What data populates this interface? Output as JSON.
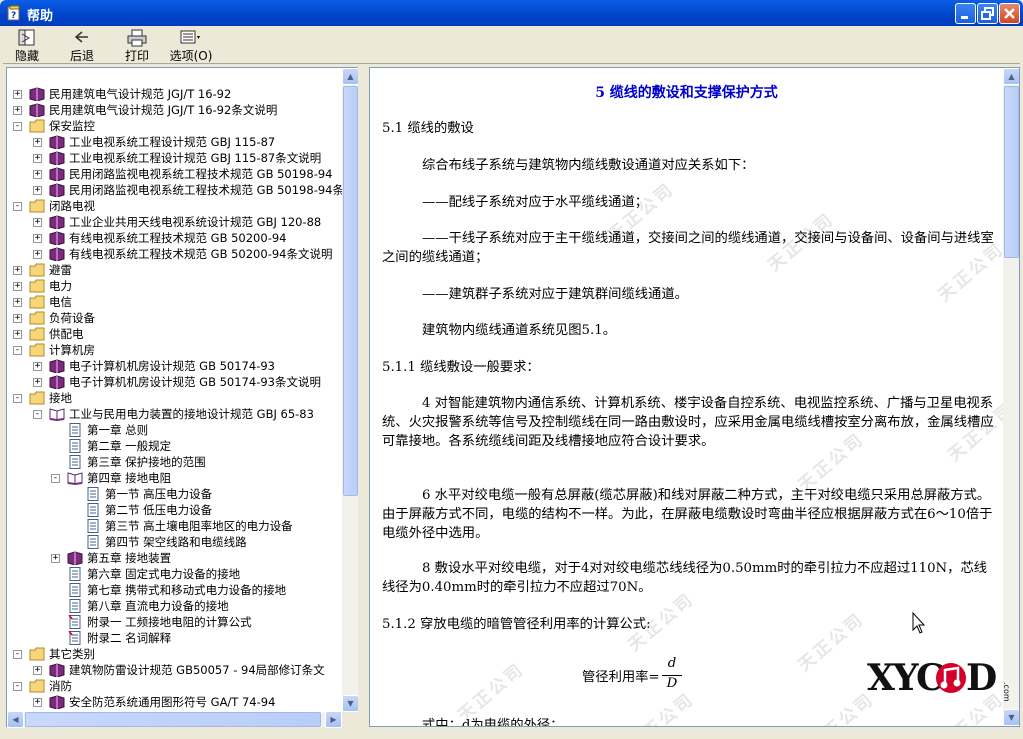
{
  "window": {
    "title": "帮助",
    "minimize_icon": "minimize-icon",
    "maximize_icon": "restore-icon",
    "close_icon": "close-icon"
  },
  "toolbar": {
    "hide": "隐藏",
    "back": "后退",
    "print": "打印",
    "options": "选项(O)"
  },
  "tree": [
    {
      "label": "民用建筑电气设计规范 JGJ/T 16-92",
      "icon": "book"
    },
    {
      "label": "民用建筑电气设计规范 JGJ/T 16-92条文说明",
      "icon": "book"
    },
    {
      "label": "保安监控",
      "icon": "folder"
    },
    {
      "label": "工业电视系统工程设计规范 GBJ 115-87",
      "icon": "book"
    },
    {
      "label": "工业电视系统工程设计规范 GBJ 115-87条文说明",
      "icon": "book"
    },
    {
      "label": "民用闭路监视电视系统工程技术规范 GB 50198-94",
      "icon": "book"
    },
    {
      "label": "民用闭路监视电视系统工程技术规范 GB 50198-94条",
      "icon": "book"
    },
    {
      "label": "闭路电视",
      "icon": "folder"
    },
    {
      "label": "工业企业共用天线电视系统设计规范 GBJ 120-88",
      "icon": "book"
    },
    {
      "label": "有线电视系统工程技术规范 GB 50200-94",
      "icon": "book"
    },
    {
      "label": "有线电视系统工程技术规范 GB 50200-94条文说明",
      "icon": "book"
    },
    {
      "label": "避雷",
      "icon": "folder"
    },
    {
      "label": "电力",
      "icon": "folder"
    },
    {
      "label": "电信",
      "icon": "folder"
    },
    {
      "label": "负荷设备",
      "icon": "folder"
    },
    {
      "label": "供配电",
      "icon": "folder"
    },
    {
      "label": "计算机房",
      "icon": "folder"
    },
    {
      "label": "电子计算机机房设计规范 GB 50174-93",
      "icon": "book"
    },
    {
      "label": "电子计算机机房设计规范 GB 50174-93条文说明",
      "icon": "book"
    },
    {
      "label": "接地",
      "icon": "folder"
    },
    {
      "label": "工业与民用电力装置的接地设计规范 GBJ 65-83",
      "icon": "openbook"
    },
    {
      "label": "第一章 总则",
      "icon": "page"
    },
    {
      "label": "第二章 一般规定",
      "icon": "page"
    },
    {
      "label": "第三章 保护接地的范围",
      "icon": "page"
    },
    {
      "label": "第四章 接地电阻",
      "icon": "openbook"
    },
    {
      "label": "第一节 高压电力设备",
      "icon": "page"
    },
    {
      "label": "第二节 低压电力设备",
      "icon": "page"
    },
    {
      "label": "第三节 高土壤电阻率地区的电力设备",
      "icon": "page"
    },
    {
      "label": "第四节 架空线路和电缆线路",
      "icon": "page"
    },
    {
      "label": "第五章 接地装置",
      "icon": "book"
    },
    {
      "label": "第六章 固定式电力设备的接地",
      "icon": "page"
    },
    {
      "label": "第七章 携带式和移动式电力设备的接地",
      "icon": "page"
    },
    {
      "label": "第八章 直流电力设备的接地",
      "icon": "page"
    },
    {
      "label": "附录一 工频接地电阻的计算公式",
      "icon": "redpage"
    },
    {
      "label": "附录二 名词解释",
      "icon": "redpage"
    },
    {
      "label": "其它类别",
      "icon": "folder"
    },
    {
      "label": "建筑物防雷设计规范 GB50057 - 94局部修订条文",
      "icon": "book"
    },
    {
      "label": "消防",
      "icon": "folder"
    },
    {
      "label": "安全防范系统通用图形符号 GA/T 74-94",
      "icon": "book"
    }
  ],
  "doc": {
    "title": "5 缆线的敷设和支撑保护方式",
    "s1": "5.1 缆线的敷设",
    "p1": "综合布线子系统与建筑物内缆线敷设通道对应关系如下：",
    "p2": "——配线子系统对应于水平缆线通道；",
    "p3": "——干线子系统对应于主干缆线通道，交接间之间的缆线通道，交接间与设备间、设备间与进线室之间的缆线通道；",
    "p4": "——建筑群子系统对应于建筑群间缆线通道。",
    "p5": "建筑物内缆线通道系统见图5.1。",
    "s2": "5.1.1 缆线敷设一般要求：",
    "p6": "4 对智能建筑物内通信系统、计算机系统、楼宇设备自控系统、电视监控系统、广播与卫星电视系统、火灾报警系统等信号及控制缆线在同一路由敷设时，应采用金属电缆线槽按室分离布放，金属线槽应可靠接地。各系统缆线间距及线槽接地应符合设计要求。",
    "p7": "6 水平对绞电缆一般有总屏蔽(缆芯屏蔽)和线对屏蔽二种方式，主干对绞电缆只采用总屏蔽方式。由于屏蔽方式不同，电缆的结构不一样。为此，在屏蔽电缆敷设时弯曲半径应根据屏蔽方式在6～10倍于电缆外径中选用。",
    "p8": "8 敷设水平对绞电缆，对于4对对绞电缆芯线线径为0.50mm时的牵引拉力不应超过110N，芯线线径为0.40mm时的牵引拉力不应超过70N。",
    "s3": "5.1.2 穿放电缆的暗管管径利用率的计算公式:",
    "formula_label": "管径利用率=",
    "formula_num": "d",
    "formula_den": "D",
    "p9": "式中：d为电缆的外径；",
    "watermark": "天正公司"
  },
  "logo": {
    "text": "XYCAD",
    "suffix": ".com",
    "color": "#d4002a"
  }
}
